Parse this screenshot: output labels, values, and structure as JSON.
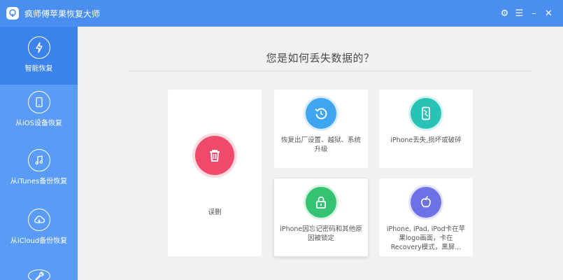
{
  "app": {
    "title": "疯师傅苹果恢复大师"
  },
  "window_controls": [
    {
      "name": "settings-button",
      "icon": "gear-icon",
      "glyph": "⚙"
    },
    {
      "name": "menu-button",
      "icon": "menu-icon",
      "glyph": "☰"
    },
    {
      "name": "minimize-button",
      "icon": "minimize-icon",
      "glyph": "–"
    },
    {
      "name": "close-button",
      "icon": "close-icon",
      "glyph": "✕"
    }
  ],
  "sidebar": {
    "items": [
      {
        "label": "智能恢复",
        "icon": "lightning-icon",
        "active": true
      },
      {
        "label": "从iOS设备恢复",
        "icon": "phone-refresh-icon",
        "active": false
      },
      {
        "label": "从iTunes备份恢复",
        "icon": "music-note-icon",
        "active": false
      },
      {
        "label": "从iCloud备份恢复",
        "icon": "cloud-icon",
        "active": false
      },
      {
        "label": "",
        "icon": "wrench-icon",
        "active": false
      }
    ]
  },
  "main": {
    "question": "您是如何丢失数据的？",
    "cards": [
      {
        "label": "误删",
        "icon": "trash-icon",
        "color": "#ef4a6b"
      },
      {
        "label": "恢复出厂设置、越狱、系统升级",
        "icon": "restore-icon",
        "color": "#3ea5ee"
      },
      {
        "label": "iPhone丢失,损坏或破碎",
        "icon": "broken-phone-icon",
        "color": "#29c2b6"
      },
      {
        "label": "iPhone因忘记密码和其他原因被锁定",
        "icon": "lock-icon",
        "color": "#33c373"
      },
      {
        "label": "iPhone, iPad, iPod卡在苹果logo画面，卡在Recovery模式，黑屏...",
        "icon": "apple-logo-icon",
        "color": "#6f72e6"
      }
    ]
  },
  "colors": {
    "titlebar": "#4a8ff0",
    "sidebar": "#5a9cf5",
    "sidebar_active": "#3d83ec",
    "background": "#f1f1f1"
  }
}
